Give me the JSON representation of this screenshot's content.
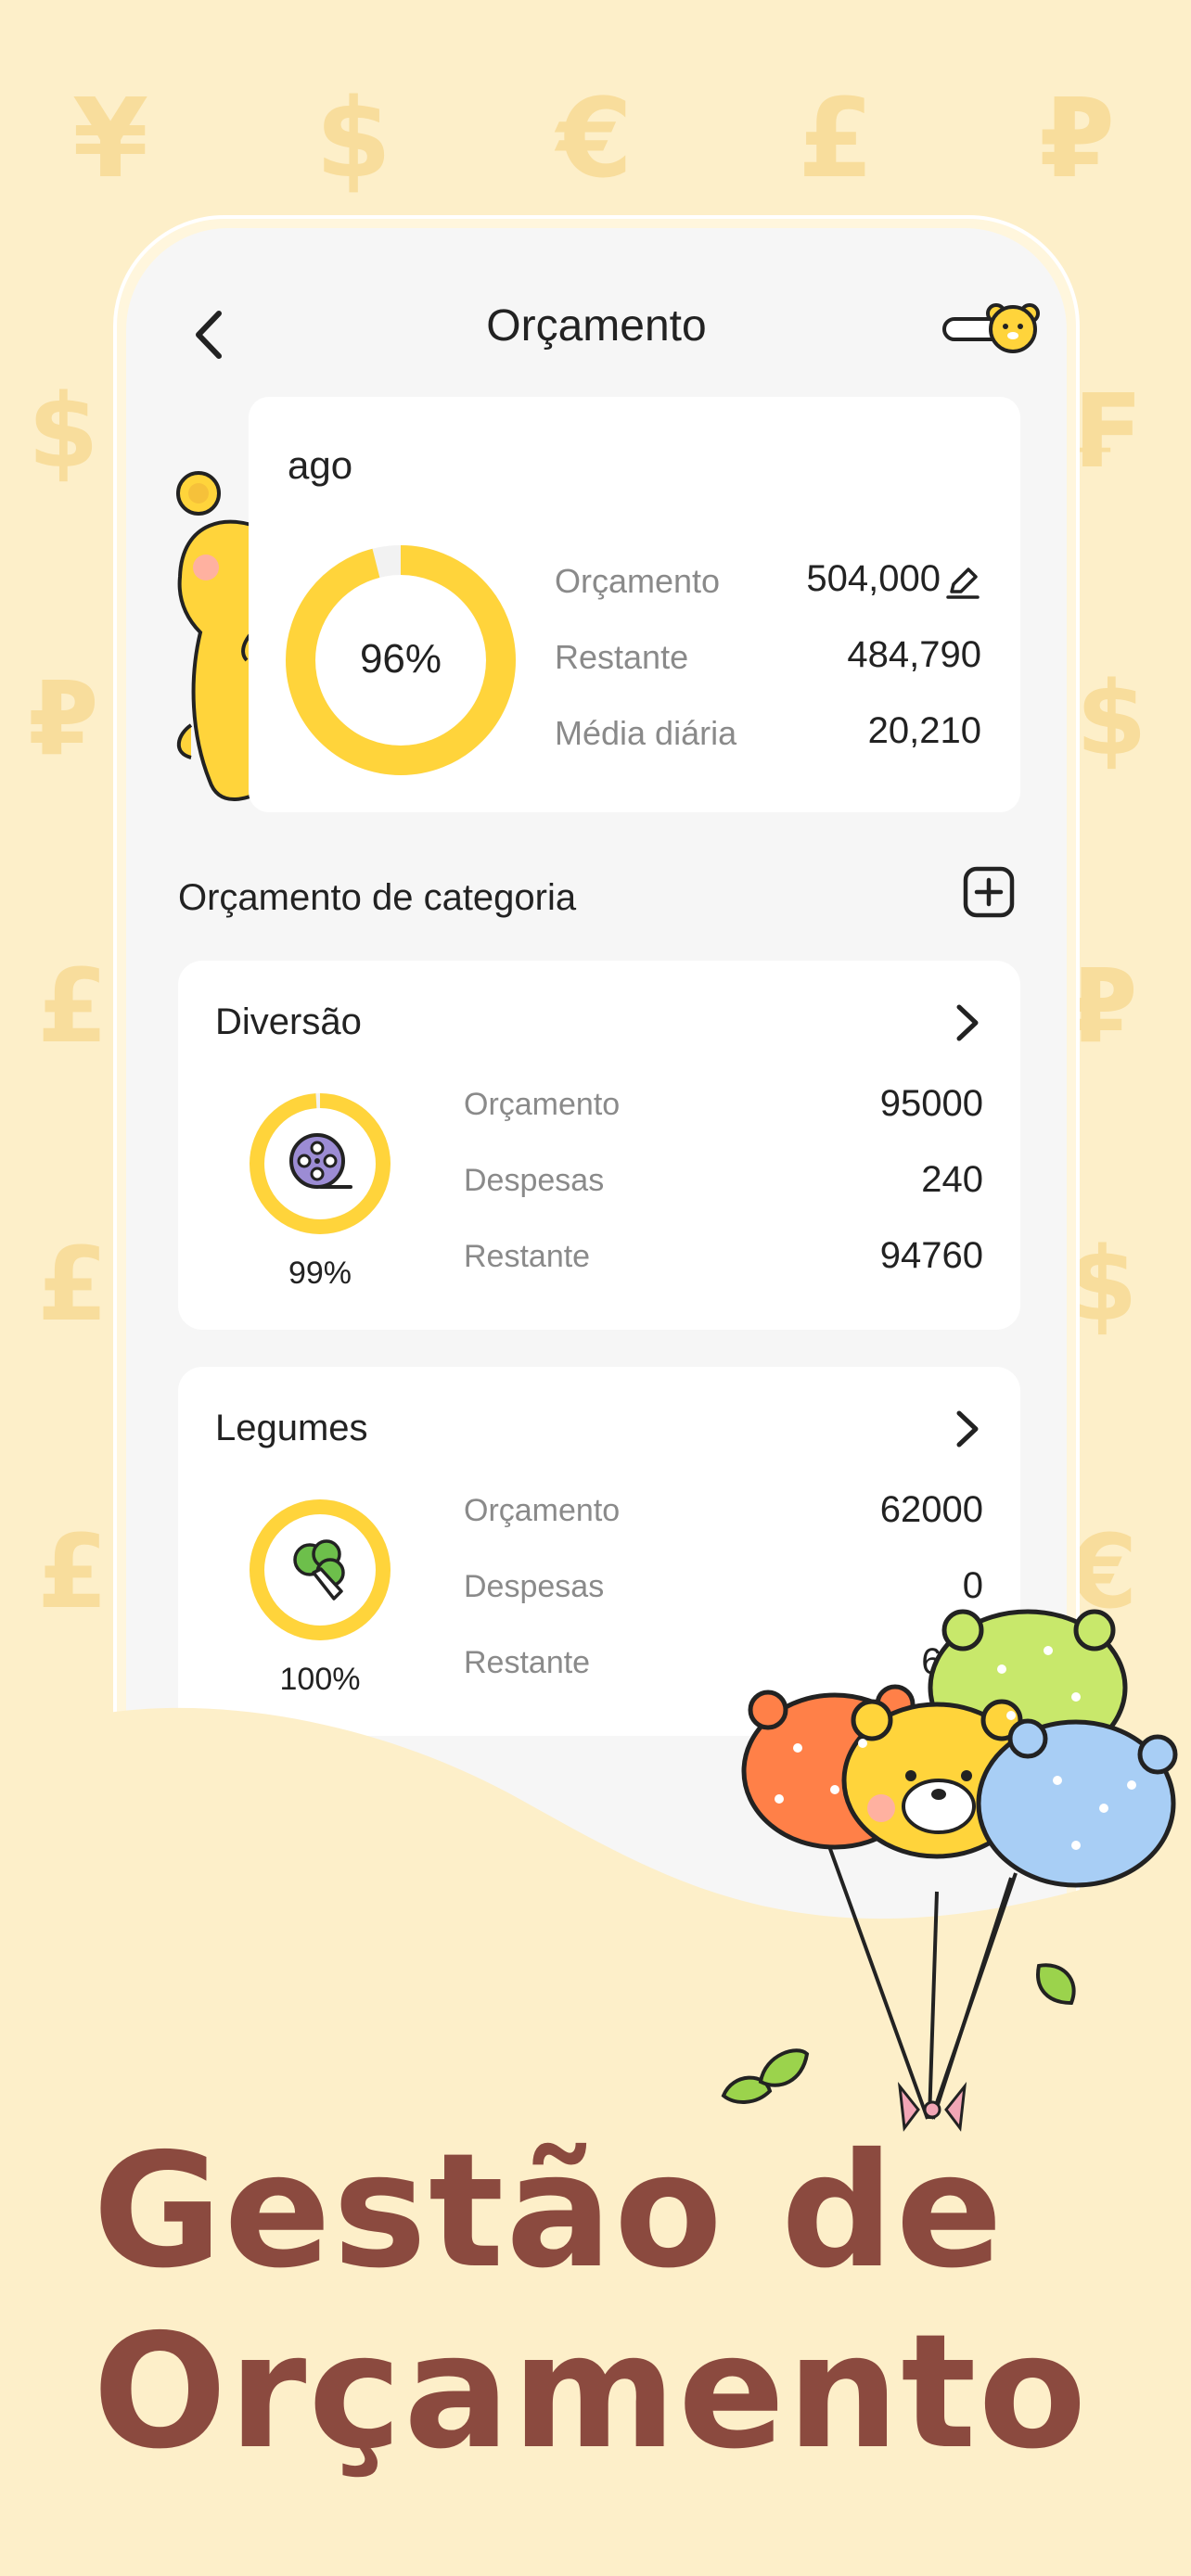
{
  "background": {
    "currency_symbols": [
      "¥",
      "$",
      "€",
      "£",
      "₽",
      "$",
      "₣",
      "₽",
      "$",
      "£",
      "₽",
      "£",
      "$",
      "£",
      "€"
    ]
  },
  "nav": {
    "title": "Orçamento",
    "back_icon": "chevron-left-icon",
    "toggle_icon": "bear-toggle-icon"
  },
  "summary": {
    "month": "ago",
    "percent": "96%",
    "percent_value": 0.96,
    "rows": [
      {
        "label": "Orçamento",
        "value": "504,000"
      },
      {
        "label": "Restante",
        "value": "484,790"
      },
      {
        "label": "Média diária",
        "value": "20,210"
      }
    ],
    "edit_icon": "pencil-icon"
  },
  "category_section": {
    "title": "Orçamento de categoria",
    "add_icon": "plus-square-icon"
  },
  "categories": [
    {
      "name": "Diversão",
      "icon": "film-reel-icon",
      "percent": "99%",
      "percent_value": 0.99,
      "rows": [
        {
          "label": "Orçamento",
          "value": "95000"
        },
        {
          "label": "Despesas",
          "value": "240"
        },
        {
          "label": "Restante",
          "value": "94760"
        }
      ]
    },
    {
      "name": "Legumes",
      "icon": "vegetable-icon",
      "percent": "100%",
      "percent_value": 1.0,
      "rows": [
        {
          "label": "Orçamento",
          "value": "62000"
        },
        {
          "label": "Despesas",
          "value": "0"
        },
        {
          "label": "Restante",
          "value": "620"
        }
      ]
    }
  ],
  "headline": {
    "line1": "Gestão de",
    "line2": "Orçamento"
  },
  "colors": {
    "background": "#FDEFC9",
    "accent_yellow": "#FFD43B",
    "headline_brown": "#8B4A3F",
    "card": "#FFFFFF",
    "screen": "#F6F6F6"
  }
}
